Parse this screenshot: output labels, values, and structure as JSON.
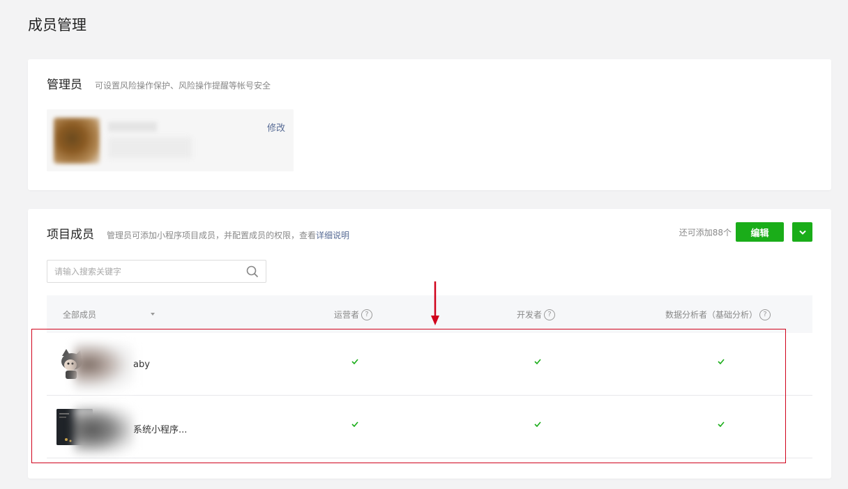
{
  "page": {
    "title": "成员管理"
  },
  "admin_section": {
    "title": "管理员",
    "description": "可设置风险操作保护、风险操作提醒等帐号安全",
    "edit_link": "修改"
  },
  "members_section": {
    "title": "项目成员",
    "description": "管理员可添加小程序项目成员，并配置成员的权限，查看",
    "description_link": "详细说明",
    "quota_text": "还可添加88个",
    "edit_button": "编辑",
    "search_placeholder": "请输入搜索关键字",
    "table": {
      "filter_label": "全部成员",
      "columns": [
        "运营者",
        "开发者",
        "数据分析者（基础分析）"
      ],
      "help_icon_text": "?",
      "rows": [
        {
          "name": "aby",
          "operator": true,
          "developer": true,
          "analyst": true
        },
        {
          "name": "系统小程序...",
          "operator": true,
          "developer": true,
          "analyst": true
        }
      ]
    }
  },
  "colors": {
    "accent_green": "#1aad19",
    "link_blue": "#576b95",
    "highlight_red": "#d0021b"
  }
}
